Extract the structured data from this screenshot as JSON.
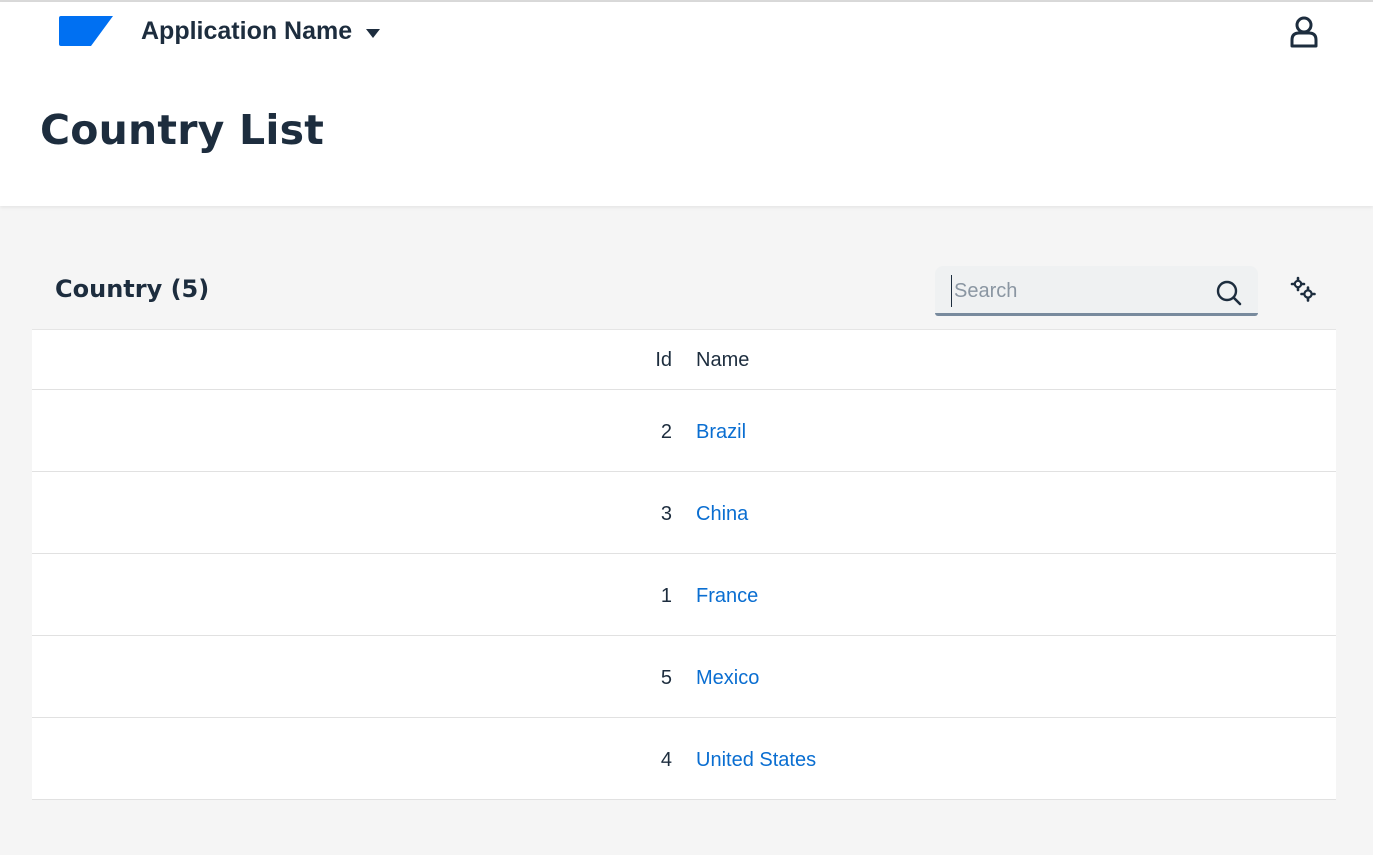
{
  "shell": {
    "app_name": "Application Name",
    "logo_color": "#0070f2",
    "icons": {
      "logo": "brand-logo",
      "dropdown": "caret-down-icon",
      "user": "user-icon"
    }
  },
  "page": {
    "title": "Country List"
  },
  "table_toolbar": {
    "title": "Country (5)",
    "search": {
      "value": "",
      "placeholder": "Search",
      "icon": "search-icon"
    },
    "settings_icon": "gears-icon"
  },
  "table": {
    "columns": [
      "Id",
      "Name"
    ],
    "rows": [
      {
        "id": "2",
        "name": "Brazil"
      },
      {
        "id": "3",
        "name": "China"
      },
      {
        "id": "1",
        "name": "France"
      },
      {
        "id": "5",
        "name": "Mexico"
      },
      {
        "id": "4",
        "name": "United States"
      }
    ],
    "link_color": "#0a6ed1"
  }
}
